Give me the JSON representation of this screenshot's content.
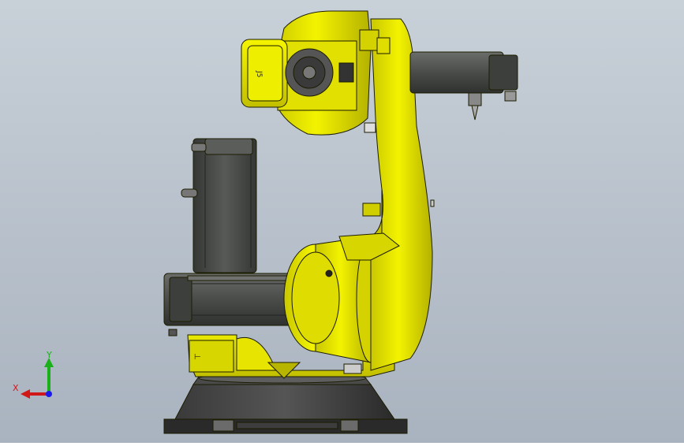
{
  "viewport": {
    "background_top": "#c8d0d8",
    "background_bottom": "#a9b3bf"
  },
  "model": {
    "name": "robot-arm",
    "body_color": "#e9e900",
    "body_shadow": "#a9a600",
    "motor_color": "#4b4d4b",
    "base_color": "#2b2b2b",
    "outline_color": "#1c1c00",
    "label_j5": "J5"
  },
  "triad": {
    "x_label": "X",
    "y_label": "Y",
    "x_color": "#d01818",
    "y_color": "#19b019",
    "z_color": "#1a1aee"
  }
}
